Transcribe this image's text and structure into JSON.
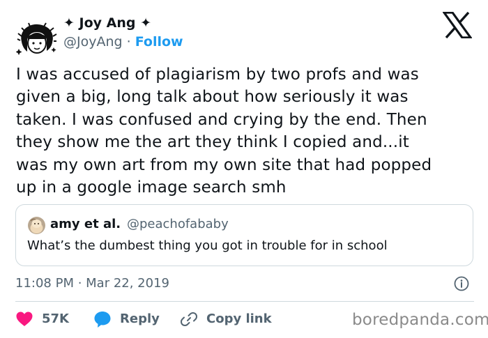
{
  "colors": {
    "text": "#0f1419",
    "secondary": "#536471",
    "link": "#1d9bf0",
    "like": "#f91880",
    "border": "#cfd9de",
    "watermark": "#8a8a8a"
  },
  "author": {
    "display_name": "✦ Joy Ang ✦",
    "handle": "@JoyAng",
    "separator": " · ",
    "follow_label": "Follow",
    "avatar_icon": "cartoon-girl-avatar"
  },
  "brand_icon": "x-logo-icon",
  "tweet": {
    "text": "I was accused of plagiarism by two profs and was\ngiven a big, long talk about how seriously it was\ntaken. I was confused and crying by the end. Then\nthey show me the art they think I copied and...it\nwas my own art from my own site that had popped\nup in a google image search smh"
  },
  "quoted": {
    "display_name": "amy et al.",
    "handle": "@peachofababy",
    "text": "What’s the dumbest thing you got in trouble for in school",
    "avatar_icon": "peach-avatar"
  },
  "timestamp": "11:08 PM · Mar 22, 2019",
  "info_icon": "info-icon",
  "actions": {
    "like_count": "57K",
    "reply_label": "Reply",
    "copy_label": "Copy link"
  },
  "watermark": "boredpanda.com"
}
